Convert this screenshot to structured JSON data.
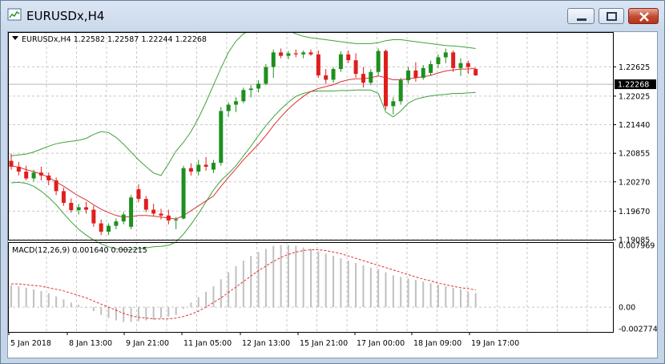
{
  "window": {
    "title": "EURUSDx,H4",
    "buttons": [
      "minimize",
      "maximize",
      "close"
    ]
  },
  "chart_header": {
    "text": "EURUSDx,H4  1.22582 1.22587 1.22244 1.22268"
  },
  "price_axis": {
    "ticks": [
      "1.22625",
      "1.22025",
      "1.21440",
      "1.20855",
      "1.20270",
      "1.19670",
      "1.19085"
    ],
    "current_price": "1.22268"
  },
  "macd": {
    "label": "MACD(12,26,9) 0.001640 0.002215",
    "ticks": [
      "0.007969",
      "0.00",
      "-0.002774"
    ]
  },
  "time_axis": {
    "ticks": [
      "5 Jan 2018",
      "8 Jan 13:00",
      "9 Jan 21:00",
      "11 Jan 05:00",
      "12 Jan 13:00",
      "15 Jan 21:00",
      "17 Jan 00:00",
      "18 Jan 09:00",
      "19 Jan 17:00"
    ]
  },
  "colors": {
    "bull": "#1e8f1e",
    "bear": "#e01e1e",
    "ma": "#e03030",
    "bands": "#3ca33c",
    "macd_hist": "#c0c0c0",
    "macd_signal": "#e03030",
    "grid": "#c8c8c8"
  },
  "chart_data": {
    "type": "candlestick",
    "ohlc": [
      [
        1.207,
        1.2085,
        1.2052,
        1.2058
      ],
      [
        1.2058,
        1.2068,
        1.204,
        1.2048
      ],
      [
        1.2048,
        1.206,
        1.203,
        1.2034
      ],
      [
        1.2034,
        1.2052,
        1.2028,
        1.2046
      ],
      [
        1.2046,
        1.2058,
        1.203,
        1.204
      ],
      [
        1.204,
        1.2046,
        1.202,
        1.203
      ],
      [
        1.203,
        1.2036,
        1.2,
        1.2008
      ],
      [
        1.2008,
        1.2015,
        1.1978,
        1.1984
      ],
      [
        1.1984,
        1.1993,
        1.1964,
        1.1969
      ],
      [
        1.1969,
        1.1982,
        1.196,
        1.1975
      ],
      [
        1.1975,
        1.1986,
        1.1962,
        1.197
      ],
      [
        1.197,
        1.1978,
        1.1935,
        1.1942
      ],
      [
        1.1942,
        1.195,
        1.1918,
        1.1925
      ],
      [
        1.1925,
        1.1942,
        1.1918,
        1.1937
      ],
      [
        1.1937,
        1.1952,
        1.193,
        1.1946
      ],
      [
        1.1946,
        1.1965,
        1.194,
        1.196
      ],
      [
        1.1935,
        1.2,
        1.193,
        1.1995
      ],
      [
        1.2012,
        1.2022,
        1.1985,
        1.1992
      ],
      [
        1.1992,
        1.1998,
        1.1965,
        1.197
      ],
      [
        1.197,
        1.1982,
        1.1958,
        1.1962
      ],
      [
        1.1962,
        1.1972,
        1.195,
        1.1958
      ],
      [
        1.1958,
        1.197,
        1.194,
        1.1948
      ],
      [
        1.1948,
        1.1955,
        1.193,
        1.195
      ],
      [
        1.1952,
        1.206,
        1.195,
        1.2055
      ],
      [
        1.2055,
        1.2065,
        1.204,
        1.2048
      ],
      [
        1.2048,
        1.2072,
        1.204,
        1.2062
      ],
      [
        1.2062,
        1.2078,
        1.205,
        1.2058
      ],
      [
        1.2052,
        1.2072,
        1.2045,
        1.2066
      ],
      [
        1.2066,
        1.218,
        1.206,
        1.2172
      ],
      [
        1.2172,
        1.219,
        1.216,
        1.2185
      ],
      [
        1.2185,
        1.22,
        1.217,
        1.2192
      ],
      [
        1.2192,
        1.222,
        1.2188,
        1.2215
      ],
      [
        1.2215,
        1.2225,
        1.22,
        1.2218
      ],
      [
        1.2218,
        1.2235,
        1.221,
        1.2228
      ],
      [
        1.2228,
        1.2268,
        1.2225,
        1.2262
      ],
      [
        1.2262,
        1.2298,
        1.224,
        1.2292
      ],
      [
        1.2292,
        1.23,
        1.228,
        1.2285
      ],
      [
        1.2285,
        1.2295,
        1.2278,
        1.229
      ],
      [
        1.229,
        1.2298,
        1.2282,
        1.2288
      ],
      [
        1.2288,
        1.2296,
        1.228,
        1.2292
      ],
      [
        1.2292,
        1.2298,
        1.2285,
        1.2288
      ],
      [
        1.2288,
        1.2296,
        1.224,
        1.2245
      ],
      [
        1.2245,
        1.2258,
        1.2228,
        1.2236
      ],
      [
        1.2236,
        1.2262,
        1.223,
        1.2258
      ],
      [
        1.2258,
        1.2294,
        1.2252,
        1.2288
      ],
      [
        1.2288,
        1.2296,
        1.227,
        1.2276
      ],
      [
        1.2276,
        1.229,
        1.224,
        1.2248
      ],
      [
        1.2248,
        1.2262,
        1.222,
        1.223
      ],
      [
        1.223,
        1.2258,
        1.2225,
        1.2252
      ],
      [
        1.2252,
        1.23,
        1.2245,
        1.2295
      ],
      [
        1.2295,
        1.2298,
        1.2175,
        1.2182
      ],
      [
        1.2182,
        1.22,
        1.2165,
        1.2192
      ],
      [
        1.2192,
        1.224,
        1.2185,
        1.2235
      ],
      [
        1.2235,
        1.2262,
        1.2228,
        1.2255
      ],
      [
        1.2255,
        1.2272,
        1.2232,
        1.224
      ],
      [
        1.224,
        1.2266,
        1.2236,
        1.226
      ],
      [
        1.225,
        1.2275,
        1.2244,
        1.2268
      ],
      [
        1.2268,
        1.2288,
        1.226,
        1.2282
      ],
      [
        1.2282,
        1.23,
        1.227,
        1.2292
      ],
      [
        1.2292,
        1.2296,
        1.2252,
        1.226
      ],
      [
        1.226,
        1.228,
        1.2244,
        1.227
      ],
      [
        1.227,
        1.2275,
        1.2248,
        1.2262
      ],
      [
        1.2258,
        1.2259,
        1.2244,
        1.2245
      ]
    ],
    "ma_series": [
      1.206,
      1.2057,
      1.2052,
      1.2048,
      1.2043,
      1.2036,
      1.2027,
      1.2018,
      1.2008,
      1.1998,
      1.199,
      1.198,
      1.1971,
      1.1964,
      1.1958,
      1.1955,
      1.1956,
      1.1958,
      1.1958,
      1.1957,
      1.1955,
      1.1953,
      1.1951,
      1.1958,
      1.1968,
      1.1978,
      1.1988,
      1.1998,
      1.2018,
      1.2036,
      1.2054,
      1.2072,
      1.2088,
      1.2104,
      1.2122,
      1.2142,
      1.216,
      1.2176,
      1.219,
      1.2202,
      1.2212,
      1.2218,
      1.2222,
      1.2226,
      1.2232,
      1.2236,
      1.2238,
      1.2238,
      1.224,
      1.2244,
      1.224,
      1.2236,
      1.2236,
      1.2238,
      1.224,
      1.2242,
      1.2245,
      1.225,
      1.2254,
      1.2256,
      1.2258,
      1.2258,
      1.226
    ],
    "upper_band": [
      1.208,
      1.2082,
      1.2084,
      1.2088,
      1.2094,
      1.21,
      1.2105,
      1.2108,
      1.211,
      1.2112,
      1.2116,
      1.2124,
      1.213,
      1.2128,
      1.2118,
      1.2104,
      1.2088,
      1.2072,
      1.2058,
      1.2045,
      1.204,
      1.2064,
      1.209,
      1.2108,
      1.213,
      1.2158,
      1.219,
      1.2225,
      1.226,
      1.2292,
      1.2315,
      1.233,
      1.2338,
      1.2342,
      1.2342,
      1.2342,
      1.234,
      1.2336,
      1.233,
      1.2325,
      1.2322,
      1.232,
      1.2318,
      1.2316,
      1.2314,
      1.2312,
      1.231,
      1.231,
      1.231,
      1.2312,
      1.2316,
      1.2318,
      1.2318,
      1.2316,
      1.2314,
      1.2312,
      1.231,
      1.2308,
      1.2306,
      1.2305,
      1.2304,
      1.2302,
      1.23
    ],
    "lower_band": [
      1.2025,
      1.2026,
      1.2024,
      1.2018,
      1.2008,
      1.1995,
      1.198,
      1.1962,
      1.1945,
      1.193,
      1.1918,
      1.1908,
      1.19,
      1.1894,
      1.189,
      1.1888,
      1.1888,
      1.189,
      1.1892,
      1.1894,
      1.1895,
      1.1897,
      1.1904,
      1.192,
      1.194,
      1.1962,
      1.1986,
      1.201,
      1.203,
      1.2044,
      1.206,
      1.208,
      1.21,
      1.2122,
      1.2142,
      1.216,
      1.2176,
      1.219,
      1.2202,
      1.2208,
      1.2212,
      1.2213,
      1.2213,
      1.2213,
      1.2214,
      1.2214,
      1.2215,
      1.2215,
      1.2215,
      1.2208,
      1.217,
      1.216,
      1.2172,
      1.2188,
      1.2196,
      1.22,
      1.2203,
      1.2205,
      1.2206,
      1.2208,
      1.2208,
      1.2209,
      1.221
    ],
    "macd_hist": [
      0.0028,
      0.0027,
      0.0025,
      0.0023,
      0.0021,
      0.0018,
      0.0014,
      0.001,
      0.0006,
      0.0003,
      -0.0001,
      -0.0005,
      -0.001,
      -0.0014,
      -0.0017,
      -0.0019,
      -0.0019,
      -0.0018,
      -0.0017,
      -0.0016,
      -0.0014,
      -0.0012,
      -0.001,
      -0.0002,
      0.0006,
      0.0013,
      0.002,
      0.0027,
      0.0036,
      0.0045,
      0.0053,
      0.006,
      0.0066,
      0.0071,
      0.0075,
      0.0079,
      0.008,
      0.008,
      0.0079,
      0.0077,
      0.0075,
      0.0072,
      0.0069,
      0.0066,
      0.0063,
      0.006,
      0.0057,
      0.0054,
      0.0051,
      0.0049,
      0.0045,
      0.0041,
      0.0039,
      0.0037,
      0.0035,
      0.0033,
      0.0031,
      0.0029,
      0.0027,
      0.0025,
      0.0023,
      0.002,
      0.0018
    ],
    "macd_signal": [
      0.003,
      0.003,
      0.0029,
      0.0028,
      0.0027,
      0.0025,
      0.0023,
      0.0021,
      0.0018,
      0.0015,
      0.0012,
      0.0008,
      0.0004,
      0.0,
      -0.0004,
      -0.0008,
      -0.0011,
      -0.0013,
      -0.0014,
      -0.0015,
      -0.0015,
      -0.0015,
      -0.0014,
      -0.0012,
      -0.0009,
      -0.0005,
      0.0,
      0.0006,
      0.0012,
      0.0019,
      0.0026,
      0.0033,
      0.004,
      0.0047,
      0.0053,
      0.0059,
      0.0064,
      0.0068,
      0.0071,
      0.0073,
      0.0074,
      0.0074,
      0.0073,
      0.0071,
      0.0069,
      0.0066,
      0.0063,
      0.006,
      0.0057,
      0.0054,
      0.0051,
      0.0048,
      0.0045,
      0.0042,
      0.0039,
      0.0036,
      0.0034,
      0.0031,
      0.0029,
      0.0027,
      0.0025,
      0.0024,
      0.0022
    ],
    "price_range": [
      1.19085,
      1.23205
    ],
    "macd_range": [
      -0.002774,
      0.007969
    ],
    "grid": true
  }
}
